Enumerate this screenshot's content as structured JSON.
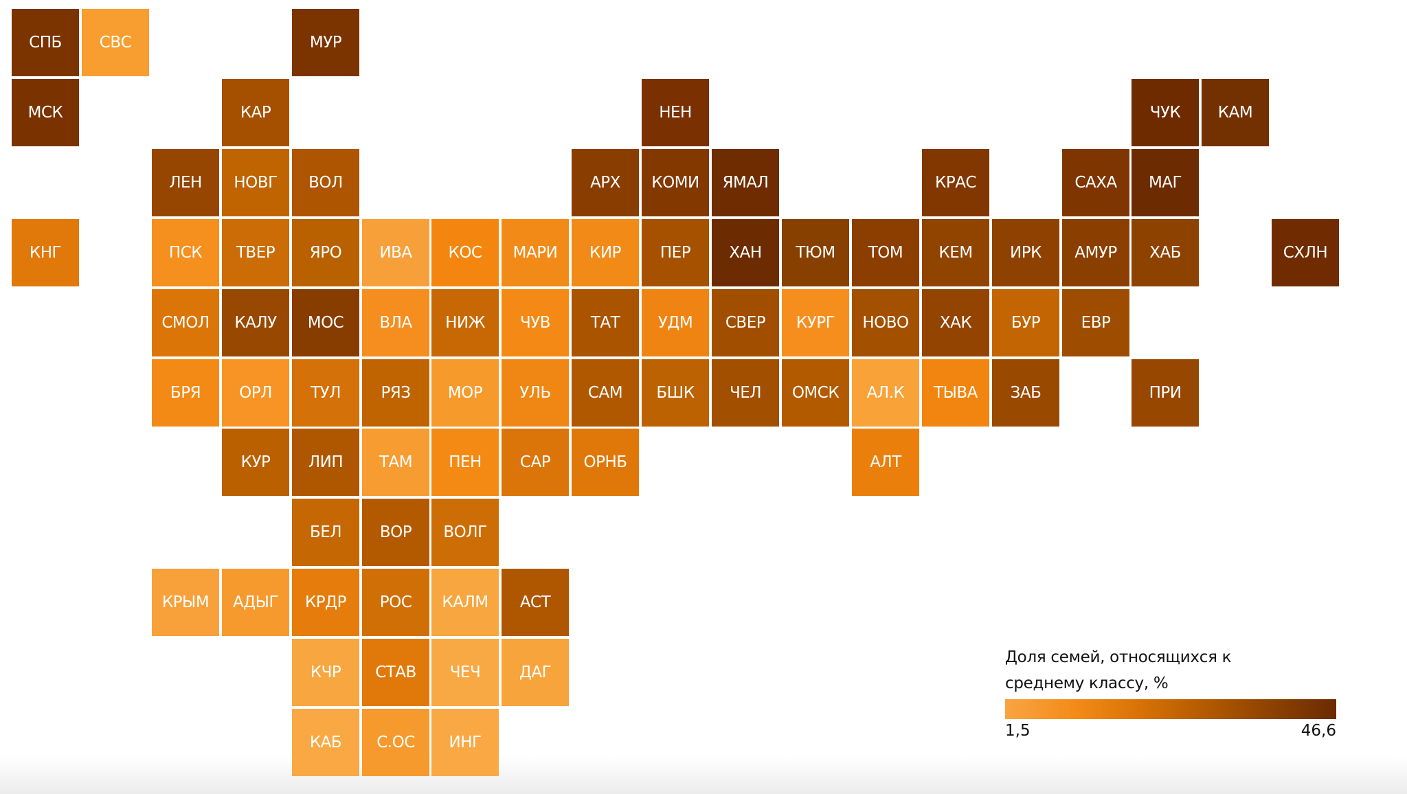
{
  "legend": {
    "title_line1": "Доля семей, относящихся к",
    "title_line2": "среднему классу, %",
    "min_label": "1,5",
    "max_label": "46,6",
    "min_color": "#F9A443",
    "max_color": "#6B2A00"
  },
  "chart_data": {
    "type": "heatmap",
    "title": "Доля семей, относящихся к среднему классу, %",
    "scale_range": [
      1.5,
      46.6
    ],
    "tiles": [
      {
        "label": "СПБ",
        "col": 0,
        "row": 0,
        "color": "#7B3300"
      },
      {
        "label": "СВС",
        "col": 1,
        "row": 0,
        "color": "#F89E30"
      },
      {
        "label": "МУР",
        "col": 4,
        "row": 0,
        "color": "#7B3300"
      },
      {
        "label": "МСК",
        "col": 0,
        "row": 1,
        "color": "#7A3300"
      },
      {
        "label": "КАР",
        "col": 3,
        "row": 1,
        "color": "#A55000"
      },
      {
        "label": "НЕН",
        "col": 9,
        "row": 1,
        "color": "#7A3000"
      },
      {
        "label": "ЧУК",
        "col": 16,
        "row": 1,
        "color": "#6F2B00"
      },
      {
        "label": "КАМ",
        "col": 17,
        "row": 1,
        "color": "#733000"
      },
      {
        "label": "ЛЕН",
        "col": 2,
        "row": 2,
        "color": "#964600"
      },
      {
        "label": "НОВГ",
        "col": 3,
        "row": 2,
        "color": "#BF6400"
      },
      {
        "label": "ВОЛ",
        "col": 4,
        "row": 2,
        "color": "#AD5500"
      },
      {
        "label": "АРХ",
        "col": 8,
        "row": 2,
        "color": "#8A3D00"
      },
      {
        "label": "КОМИ",
        "col": 9,
        "row": 2,
        "color": "#833800"
      },
      {
        "label": "ЯМАЛ",
        "col": 10,
        "row": 2,
        "color": "#6E2C00"
      },
      {
        "label": "КРАС",
        "col": 13,
        "row": 2,
        "color": "#823700"
      },
      {
        "label": "САХА",
        "col": 15,
        "row": 2,
        "color": "#7E3500"
      },
      {
        "label": "МАГ",
        "col": 16,
        "row": 2,
        "color": "#6C2B00"
      },
      {
        "label": "КНГ",
        "col": 0,
        "row": 3,
        "color": "#E0780A"
      },
      {
        "label": "ПСК",
        "col": 2,
        "row": 3,
        "color": "#F58F1E"
      },
      {
        "label": "ТВЕР",
        "col": 3,
        "row": 3,
        "color": "#CB6C06"
      },
      {
        "label": "ЯРО",
        "col": 4,
        "row": 3,
        "color": "#B96000"
      },
      {
        "label": "ИВА",
        "col": 5,
        "row": 3,
        "color": "#F7A03A"
      },
      {
        "label": "КОС",
        "col": 6,
        "row": 3,
        "color": "#F4860F"
      },
      {
        "label": "МАРИ",
        "col": 7,
        "row": 3,
        "color": "#F28A18"
      },
      {
        "label": "КИР",
        "col": 8,
        "row": 3,
        "color": "#F28A17"
      },
      {
        "label": "ПЕР",
        "col": 9,
        "row": 3,
        "color": "#A65100"
      },
      {
        "label": "ХАН",
        "col": 10,
        "row": 3,
        "color": "#6C2B00"
      },
      {
        "label": "ТЮМ",
        "col": 11,
        "row": 3,
        "color": "#874000"
      },
      {
        "label": "ТОМ",
        "col": 12,
        "row": 3,
        "color": "#8B3E00"
      },
      {
        "label": "КЕМ",
        "col": 13,
        "row": 3,
        "color": "#914300"
      },
      {
        "label": "ИРК",
        "col": 14,
        "row": 3,
        "color": "#8E4100"
      },
      {
        "label": "АМУР",
        "col": 15,
        "row": 3,
        "color": "#8A3F00"
      },
      {
        "label": "ХАБ",
        "col": 16,
        "row": 3,
        "color": "#8E4200"
      },
      {
        "label": "СХЛН",
        "col": 18,
        "row": 3,
        "color": "#702C00"
      },
      {
        "label": "СМОЛ",
        "col": 2,
        "row": 4,
        "color": "#DC7508"
      },
      {
        "label": "КАЛУ",
        "col": 3,
        "row": 4,
        "color": "#984800"
      },
      {
        "label": "МОС",
        "col": 4,
        "row": 4,
        "color": "#873C00"
      },
      {
        "label": "ВЛА",
        "col": 5,
        "row": 4,
        "color": "#F58E1E"
      },
      {
        "label": "НИЖ",
        "col": 6,
        "row": 4,
        "color": "#C86804"
      },
      {
        "label": "ЧУВ",
        "col": 7,
        "row": 4,
        "color": "#F48915"
      },
      {
        "label": "ТАТ",
        "col": 8,
        "row": 4,
        "color": "#AA5400"
      },
      {
        "label": "УДМ",
        "col": 9,
        "row": 4,
        "color": "#F08412"
      },
      {
        "label": "СВЕР",
        "col": 10,
        "row": 4,
        "color": "#A24E00"
      },
      {
        "label": "КУРГ",
        "col": 11,
        "row": 4,
        "color": "#F68E1E"
      },
      {
        "label": "НОВО",
        "col": 12,
        "row": 4,
        "color": "#A35000"
      },
      {
        "label": "ХАК",
        "col": 13,
        "row": 4,
        "color": "#924400"
      },
      {
        "label": "БУР",
        "col": 14,
        "row": 4,
        "color": "#C26502"
      },
      {
        "label": "ЕВР",
        "col": 15,
        "row": 4,
        "color": "#9E4D00"
      },
      {
        "label": "БРЯ",
        "col": 2,
        "row": 5,
        "color": "#F48A16"
      },
      {
        "label": "ОРЛ",
        "col": 3,
        "row": 5,
        "color": "#F79425"
      },
      {
        "label": "ТУЛ",
        "col": 4,
        "row": 5,
        "color": "#D47108"
      },
      {
        "label": "РЯЗ",
        "col": 5,
        "row": 5,
        "color": "#C06402"
      },
      {
        "label": "МОР",
        "col": 6,
        "row": 5,
        "color": "#F79A2C"
      },
      {
        "label": "УЛЬ",
        "col": 7,
        "row": 5,
        "color": "#F08614"
      },
      {
        "label": "САМ",
        "col": 8,
        "row": 5,
        "color": "#B05800"
      },
      {
        "label": "БШК",
        "col": 9,
        "row": 5,
        "color": "#BD6202"
      },
      {
        "label": "ЧЕЛ",
        "col": 10,
        "row": 5,
        "color": "#A24F00"
      },
      {
        "label": "ОМСК",
        "col": 11,
        "row": 5,
        "color": "#B25A00"
      },
      {
        "label": "АЛ.К",
        "col": 12,
        "row": 5,
        "color": "#F8A238"
      },
      {
        "label": "ТЫВА",
        "col": 13,
        "row": 5,
        "color": "#F2850F"
      },
      {
        "label": "ЗАБ",
        "col": 14,
        "row": 5,
        "color": "#994900"
      },
      {
        "label": "ПРИ",
        "col": 16,
        "row": 5,
        "color": "#974700"
      },
      {
        "label": "КУР",
        "col": 3,
        "row": 6,
        "color": "#BA6000"
      },
      {
        "label": "ЛИП",
        "col": 4,
        "row": 6,
        "color": "#AE5600"
      },
      {
        "label": "ТАМ",
        "col": 5,
        "row": 6,
        "color": "#F79C30"
      },
      {
        "label": "ПЕН",
        "col": 6,
        "row": 6,
        "color": "#F48A14"
      },
      {
        "label": "САР",
        "col": 7,
        "row": 6,
        "color": "#DB7409"
      },
      {
        "label": "ОРНБ",
        "col": 8,
        "row": 6,
        "color": "#E07809"
      },
      {
        "label": "АЛТ",
        "col": 12,
        "row": 6,
        "color": "#EA800B"
      },
      {
        "label": "БЕЛ",
        "col": 4,
        "row": 7,
        "color": "#C56804"
      },
      {
        "label": "ВОР",
        "col": 5,
        "row": 7,
        "color": "#B35A00"
      },
      {
        "label": "ВОЛГ",
        "col": 6,
        "row": 7,
        "color": "#CD6D06"
      },
      {
        "label": "КРЫМ",
        "col": 2,
        "row": 8,
        "color": "#F8A039"
      },
      {
        "label": "АДЫГ",
        "col": 3,
        "row": 8,
        "color": "#F69A2E"
      },
      {
        "label": "КРДР",
        "col": 4,
        "row": 8,
        "color": "#E57C0B"
      },
      {
        "label": "РОС",
        "col": 5,
        "row": 8,
        "color": "#D16F07"
      },
      {
        "label": "КАЛМ",
        "col": 6,
        "row": 8,
        "color": "#F8A63F"
      },
      {
        "label": "АСТ",
        "col": 7,
        "row": 8,
        "color": "#AF5700"
      },
      {
        "label": "КЧР",
        "col": 4,
        "row": 9,
        "color": "#F8A640"
      },
      {
        "label": "СТАВ",
        "col": 5,
        "row": 9,
        "color": "#E0790A"
      },
      {
        "label": "ЧЕЧ",
        "col": 6,
        "row": 9,
        "color": "#F9A944"
      },
      {
        "label": "ДАГ",
        "col": 7,
        "row": 9,
        "color": "#F8A43D"
      },
      {
        "label": "КАБ",
        "col": 4,
        "row": 10,
        "color": "#F9A843"
      },
      {
        "label": "С.ОС",
        "col": 5,
        "row": 10,
        "color": "#F69A2D"
      },
      {
        "label": "ИНГ",
        "col": 6,
        "row": 10,
        "color": "#F9A844"
      }
    ]
  }
}
